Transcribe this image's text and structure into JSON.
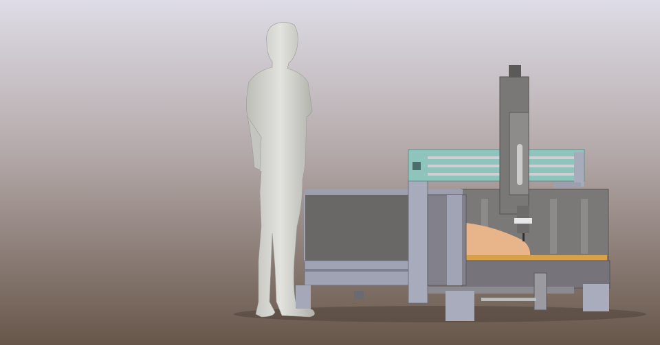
{
  "scene": {
    "colors": {
      "sky_top": "#dcdae3",
      "sky_mid": "#a99c98",
      "floor": "#6b5b50",
      "figure": "#d6d6d2",
      "figure_shade": "#a8a8a4",
      "frame": "#7c7a78",
      "frame_dark": "#5d5b5a",
      "frame_light": "#a6a9b8",
      "gantry_accent": "#8fc4bd",
      "workpiece": "#e8b48a",
      "bed": "#d9a04a"
    }
  }
}
